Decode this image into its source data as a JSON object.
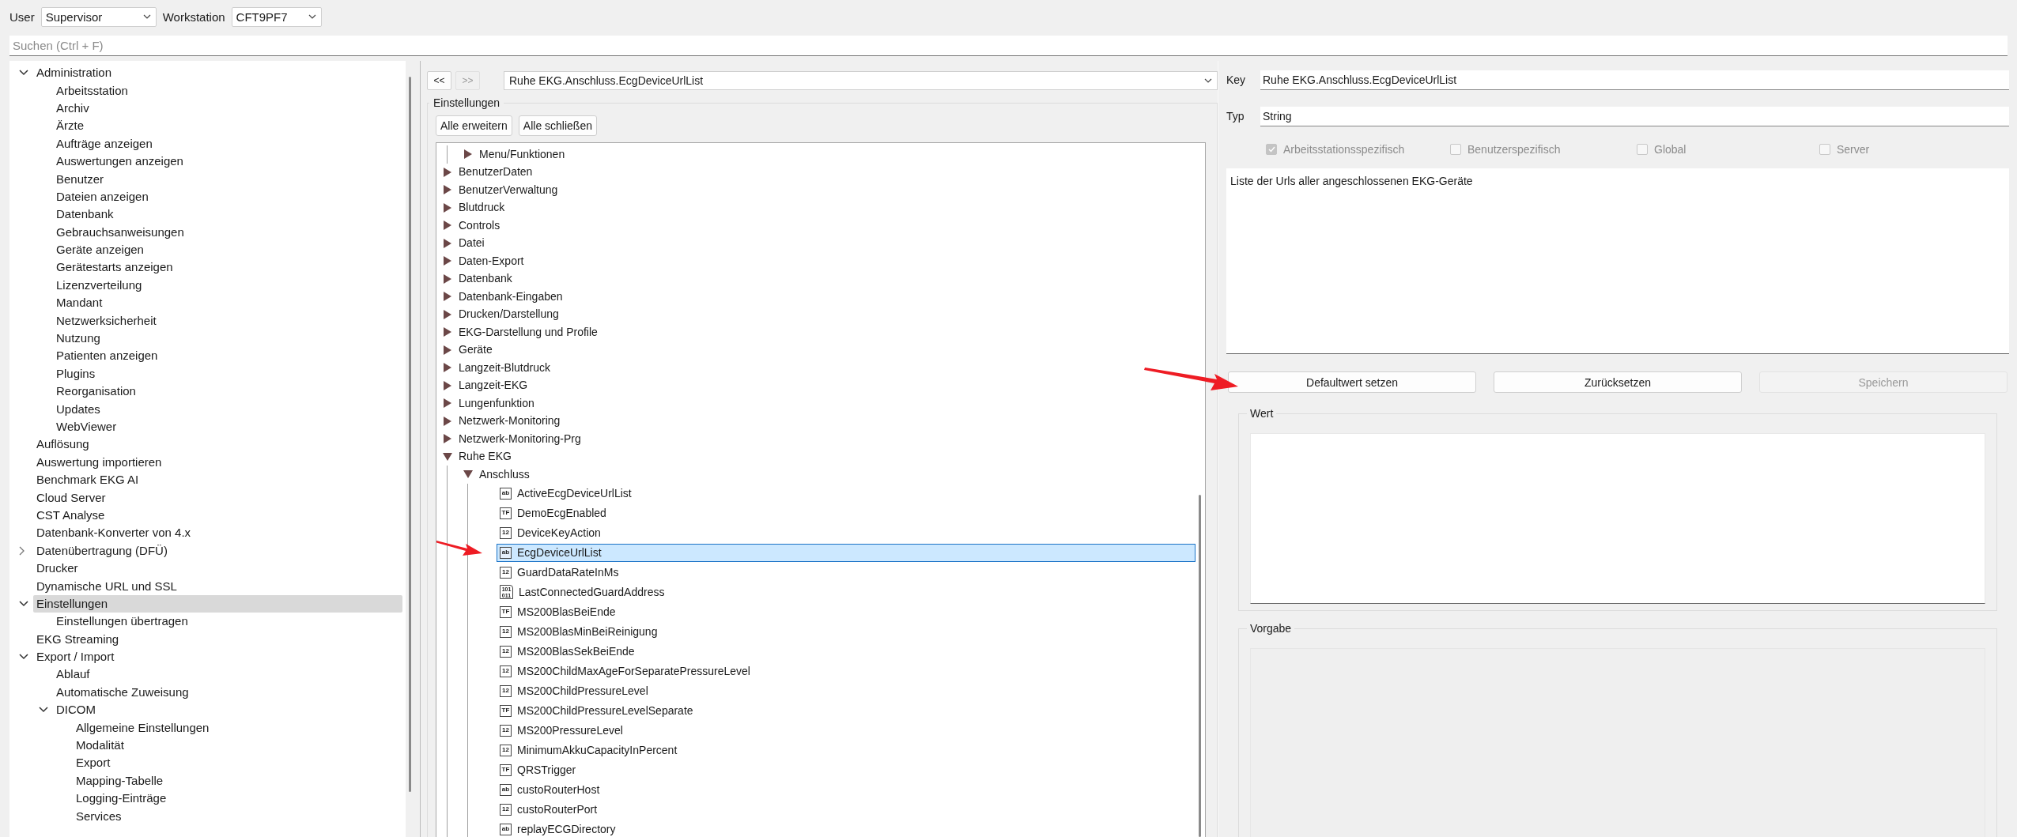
{
  "top_bar": {
    "user_label": "User",
    "user": "Supervisor",
    "workstation_label": "Workstation",
    "workstation": "CFT9PF7"
  },
  "search": {
    "placeholder": "Suchen (Ctrl + F)"
  },
  "nav_tree": {
    "items": [
      {
        "label": "Administration",
        "expanded": true,
        "selected": false,
        "children": [
          {
            "label": "Arbeitsstation",
            "selected": false
          },
          {
            "label": "Archiv",
            "selected": false
          },
          {
            "label": "Ärzte",
            "selected": false
          },
          {
            "label": "Aufträge anzeigen",
            "selected": false
          },
          {
            "label": "Auswertungen anzeigen",
            "selected": false
          },
          {
            "label": "Benutzer",
            "selected": false
          },
          {
            "label": "Dateien anzeigen",
            "selected": false
          },
          {
            "label": "Datenbank",
            "selected": false
          },
          {
            "label": "Gebrauchsanweisungen",
            "selected": false
          },
          {
            "label": "Geräte anzeigen",
            "selected": false
          },
          {
            "label": "Gerätestarts anzeigen",
            "selected": false
          },
          {
            "label": "Lizenzverteilung",
            "selected": false
          },
          {
            "label": "Mandant",
            "selected": false
          },
          {
            "label": "Netzwerksicherheit",
            "selected": false
          },
          {
            "label": "Nutzung",
            "selected": false
          },
          {
            "label": "Patienten anzeigen",
            "selected": false
          },
          {
            "label": "Plugins",
            "selected": false
          },
          {
            "label": "Reorganisation",
            "selected": false
          },
          {
            "label": "Updates",
            "selected": false
          },
          {
            "label": "WebViewer",
            "selected": false
          }
        ]
      },
      {
        "label": "Auflösung",
        "selected": false
      },
      {
        "label": "Auswertung importieren",
        "selected": false
      },
      {
        "label": "Benchmark EKG AI",
        "selected": false
      },
      {
        "label": "Cloud Server",
        "selected": false
      },
      {
        "label": "CST Analyse",
        "selected": false
      },
      {
        "label": "Datenbank-Konverter von 4.x",
        "selected": false
      },
      {
        "label": "Datenübertragung (DFÜ)",
        "expanded": false,
        "selected": false
      },
      {
        "label": "Drucker",
        "selected": false
      },
      {
        "label": "Dynamische URL und SSL",
        "selected": false
      },
      {
        "label": "Einstellungen",
        "expanded": true,
        "selected": true,
        "children": [
          {
            "label": "Einstellungen übertragen",
            "selected": false
          }
        ]
      },
      {
        "label": "EKG Streaming",
        "selected": false
      },
      {
        "label": "Export / Import",
        "expanded": true,
        "selected": false,
        "children": [
          {
            "label": "Ablauf",
            "selected": false
          },
          {
            "label": "Automatische Zuweisung",
            "selected": false
          },
          {
            "label": "DICOM",
            "expanded": true,
            "selected": false,
            "children": [
              {
                "label": "Allgemeine Einstellungen",
                "selected": false
              },
              {
                "label": "Modalität",
                "selected": false
              },
              {
                "label": "Export",
                "selected": false
              },
              {
                "label": "Mapping-Tabelle",
                "selected": false
              },
              {
                "label": "Logging-Einträge",
                "selected": false
              },
              {
                "label": "Services",
                "selected": false
              }
            ]
          }
        ]
      }
    ]
  },
  "settings_panel": {
    "back_button": {
      "label": "<<",
      "disabled": false
    },
    "forward_button": {
      "label": ">>",
      "disabled": true
    },
    "path": "Ruhe EKG.Anschluss.EcgDeviceUrlList",
    "group_title": "Einstellungen",
    "buttons": [
      {
        "label": "Alle erweitern"
      },
      {
        "label": "Alle schließen"
      }
    ],
    "tree": {
      "continued_children": [
        {
          "label": "Menu/Funktionen",
          "expanded": false,
          "selected": false
        }
      ],
      "items": [
        {
          "label": "BenutzerDaten",
          "expanded": false,
          "selected": false
        },
        {
          "label": "BenutzerVerwaltung",
          "expanded": false,
          "selected": false
        },
        {
          "label": "Blutdruck",
          "expanded": false,
          "selected": false
        },
        {
          "label": "Controls",
          "expanded": false,
          "selected": false
        },
        {
          "label": "Datei",
          "expanded": false,
          "selected": false
        },
        {
          "label": "Daten-Export",
          "expanded": false,
          "selected": false
        },
        {
          "label": "Datenbank",
          "expanded": false,
          "selected": false
        },
        {
          "label": "Datenbank-Eingaben",
          "expanded": false,
          "selected": false
        },
        {
          "label": "Drucken/Darstellung",
          "expanded": false,
          "selected": false
        },
        {
          "label": "EKG-Darstellung und Profile",
          "expanded": false,
          "selected": false
        },
        {
          "label": "Geräte",
          "expanded": false,
          "selected": false
        },
        {
          "label": "Langzeit-Blutdruck",
          "expanded": false,
          "selected": false
        },
        {
          "label": "Langzeit-EKG",
          "expanded": false,
          "selected": false
        },
        {
          "label": "Lungenfunktion",
          "expanded": false,
          "selected": false
        },
        {
          "label": "Netzwerk-Monitoring",
          "expanded": false,
          "selected": false
        },
        {
          "label": "Netzwerk-Monitoring-Prg",
          "expanded": false,
          "selected": false
        },
        {
          "label": "Ruhe EKG",
          "expanded": true,
          "selected": false,
          "children": [
            {
              "label": "Anschluss",
              "expanded": true,
              "selected": false,
              "children": [
                {
                  "label": "ActiveEcgDeviceUrlList",
                  "kind": "box",
                  "badge": "ab",
                  "selected": false
                },
                {
                  "label": "DemoEcgEnabled",
                  "kind": "box",
                  "badge": "TF",
                  "selected": false
                },
                {
                  "label": "DeviceKeyAction",
                  "kind": "box",
                  "badge": "12",
                  "selected": false
                },
                {
                  "label": "EcgDeviceUrlList",
                  "kind": "box",
                  "badge": "ab",
                  "selected": true,
                  "pointed_at": true
                },
                {
                  "label": "GuardDataRateInMs",
                  "kind": "box",
                  "badge": "12",
                  "selected": false
                },
                {
                  "label": "LastConnectedGuardAddress",
                  "kind": "file",
                  "badge": "101 011",
                  "selected": false
                },
                {
                  "label": "MS200BlasBeiEnde",
                  "kind": "box",
                  "badge": "TF",
                  "selected": false
                },
                {
                  "label": "MS200BlasMinBeiReinigung",
                  "kind": "box",
                  "badge": "12",
                  "selected": false
                },
                {
                  "label": "MS200BlasSekBeiEnde",
                  "kind": "box",
                  "badge": "12",
                  "selected": false
                },
                {
                  "label": "MS200ChildMaxAgeForSeparatePressureLevel",
                  "kind": "box",
                  "badge": "12",
                  "selected": false
                },
                {
                  "label": "MS200ChildPressureLevel",
                  "kind": "box",
                  "badge": "12",
                  "selected": false
                },
                {
                  "label": "MS200ChildPressureLevelSeparate",
                  "kind": "box",
                  "badge": "TF",
                  "selected": false
                },
                {
                  "label": "MS200PressureLevel",
                  "kind": "box",
                  "badge": "12",
                  "selected": false
                },
                {
                  "label": "MinimumAkkuCapacityInPercent",
                  "kind": "box",
                  "badge": "12",
                  "selected": false
                },
                {
                  "label": "QRSTrigger",
                  "kind": "box",
                  "badge": "TF",
                  "selected": false
                },
                {
                  "label": "custoRouterHost",
                  "kind": "box",
                  "badge": "ab",
                  "selected": false
                },
                {
                  "label": "custoRouterPort",
                  "kind": "box",
                  "badge": "12",
                  "selected": false
                },
                {
                  "label": "replayECGDirectory",
                  "kind": "box",
                  "badge": "ab",
                  "selected": false
                }
              ]
            }
          ]
        }
      ]
    }
  },
  "detail": {
    "fields": [
      {
        "label": "Key",
        "value": "Ruhe EKG.Anschluss.EcgDeviceUrlList"
      },
      {
        "label": "Typ",
        "value": "String"
      }
    ],
    "scopes": [
      {
        "label": "Arbeitsstationsspezifisch",
        "checked": true,
        "disabled": true
      },
      {
        "label": "Benutzerspezifisch",
        "checked": false,
        "disabled": true
      },
      {
        "label": "Global",
        "checked": false,
        "disabled": true
      },
      {
        "label": "Server",
        "checked": false,
        "disabled": true
      }
    ],
    "description": "Liste der Urls aller angeschlossenen EKG-Geräte",
    "buttons": [
      {
        "label": "Defaultwert setzen",
        "disabled": false,
        "pointed_at": true
      },
      {
        "label": "Zurücksetzen",
        "disabled": false
      },
      {
        "label": "Speichern",
        "disabled": true
      }
    ],
    "value_groups": [
      {
        "title": "Wert",
        "disabled": false
      },
      {
        "title": "Vorgabe",
        "disabled": true
      }
    ]
  }
}
